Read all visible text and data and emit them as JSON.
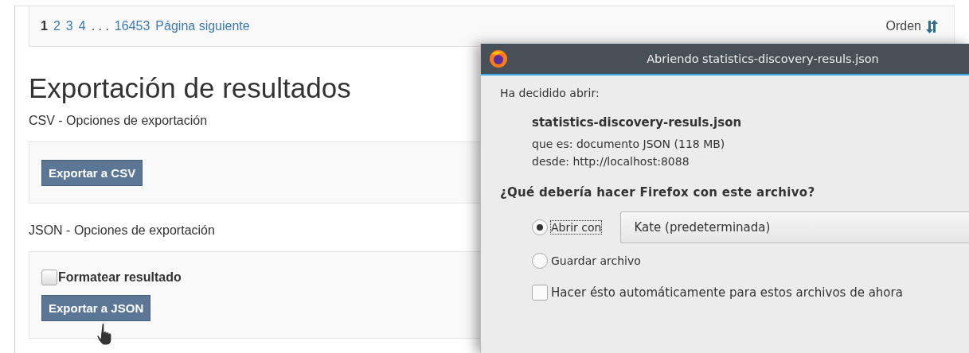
{
  "pagination": {
    "pages": [
      {
        "label": "1",
        "selected": true
      },
      {
        "label": "2",
        "selected": false
      },
      {
        "label": "3",
        "selected": false
      },
      {
        "label": "4",
        "selected": false
      }
    ],
    "ellipsis": ". . .",
    "last": "16453",
    "next": "Página siguiente"
  },
  "sort": {
    "label": "Orden"
  },
  "heading": "Exportación de resultados",
  "sections": [
    {
      "title": "CSV - Opciones de exportación",
      "button": "Exportar a CSV"
    },
    {
      "title": "JSON - Opciones de exportación",
      "checkbox": {
        "label": "Formatear resultado",
        "checked": false
      },
      "button": "Exportar a JSON"
    }
  ],
  "dialog": {
    "title": "Abriendo statistics-discovery-resuls.json",
    "intro": "Ha decidido abrir:",
    "filename": "statistics-discovery-resuls.json",
    "type_line": "que es: documento JSON (118 MB)",
    "from_line": "desde: http://localhost:8088",
    "question": "¿Qué debería hacer Firefox con este archivo?",
    "options": [
      {
        "label": "Abrir con",
        "selected": true,
        "app": "Kate (predeterminada)"
      },
      {
        "label": "Guardar archivo",
        "selected": false
      }
    ],
    "remember": {
      "label": "Hacer ésto automáticamente para estos archivos de ahora",
      "checked": false
    }
  }
}
